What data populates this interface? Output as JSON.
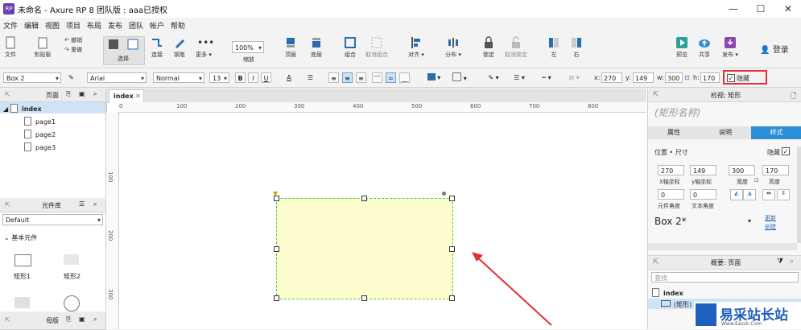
{
  "window": {
    "title": "未命名 - Axure RP 8 团队版 : aaa已授权",
    "logo": "RP",
    "minimize": "—",
    "maximize": "☐",
    "close": "✕"
  },
  "menu": [
    "文件",
    "编辑",
    "视图",
    "项目",
    "布局",
    "发布",
    "团队",
    "帐户",
    "帮助"
  ],
  "toolbar": {
    "file": "文件",
    "clipboard": "剪贴板",
    "undo": "撤销",
    "redo": "重做",
    "select": "选择",
    "connect": "连接",
    "pen": "钢笔",
    "more": "更多 ▾",
    "zoom_value": "100%",
    "zoom": "缩放",
    "top": "顶层",
    "bottom": "底层",
    "group": "组合",
    "ungroup": "取消组合",
    "align": "对齐 ▾",
    "distribute": "分布 ▾",
    "lock": "锁定",
    "unlock": "取消锁定",
    "left": "左",
    "right": "右",
    "preview": "预览",
    "share": "共享",
    "publish": "发布 ▾",
    "login": "登录"
  },
  "format": {
    "widget_name": "Box 2",
    "font": "Arial",
    "style": "Normal",
    "size": "13",
    "bold": "B",
    "italic": "I",
    "underline": "U",
    "font_color": "A",
    "x_label": "x:",
    "x": "270",
    "y_label": "y:",
    "y": "149",
    "w_label": "w:",
    "w": "300",
    "h_label": "h:",
    "h": "170",
    "hide_label": "隐藏",
    "hide_checked": true
  },
  "pages_panel": {
    "title": "页面",
    "items": [
      "index",
      "page1",
      "page2",
      "page3"
    ]
  },
  "library_panel": {
    "title": "元件库",
    "selected": "Default",
    "group": "基本元件",
    "items": [
      "矩形1",
      "矩形2"
    ]
  },
  "masters_panel": {
    "title": "母版"
  },
  "canvas": {
    "tab": "index",
    "ruler_top": [
      "0",
      "100",
      "200",
      "300",
      "400",
      "500",
      "600",
      "700",
      "800"
    ],
    "ruler_left": [
      "100",
      "200",
      "300"
    ],
    "shape_fill": "#fdfdd0",
    "shape_border": "#44cc44"
  },
  "inspector": {
    "title": "检视: 矩形",
    "shape_name_placeholder": "(矩形名称)",
    "tabs": [
      "属性",
      "说明",
      "样式"
    ],
    "section": "位置 • 尺寸",
    "hidden_label": "隐藏",
    "x": "270",
    "y": "149",
    "w": "300",
    "h": "170",
    "x_caption": "X轴坐标",
    "y_caption": "y轴坐标",
    "w_caption": "宽度",
    "h_caption": "高度",
    "rot": "0",
    "text_rot": "0",
    "rot_caption": "元件角度",
    "text_rot_caption": "文本角度",
    "style_name": "Box 2*",
    "update": "更新",
    "create": "创建"
  },
  "outline": {
    "title": "概要: 页面",
    "search_placeholder": "查找",
    "page": "index",
    "child": "(矩形)"
  },
  "watermark": {
    "text": "易采站长站",
    "sub": "Www.Easck.Com"
  }
}
